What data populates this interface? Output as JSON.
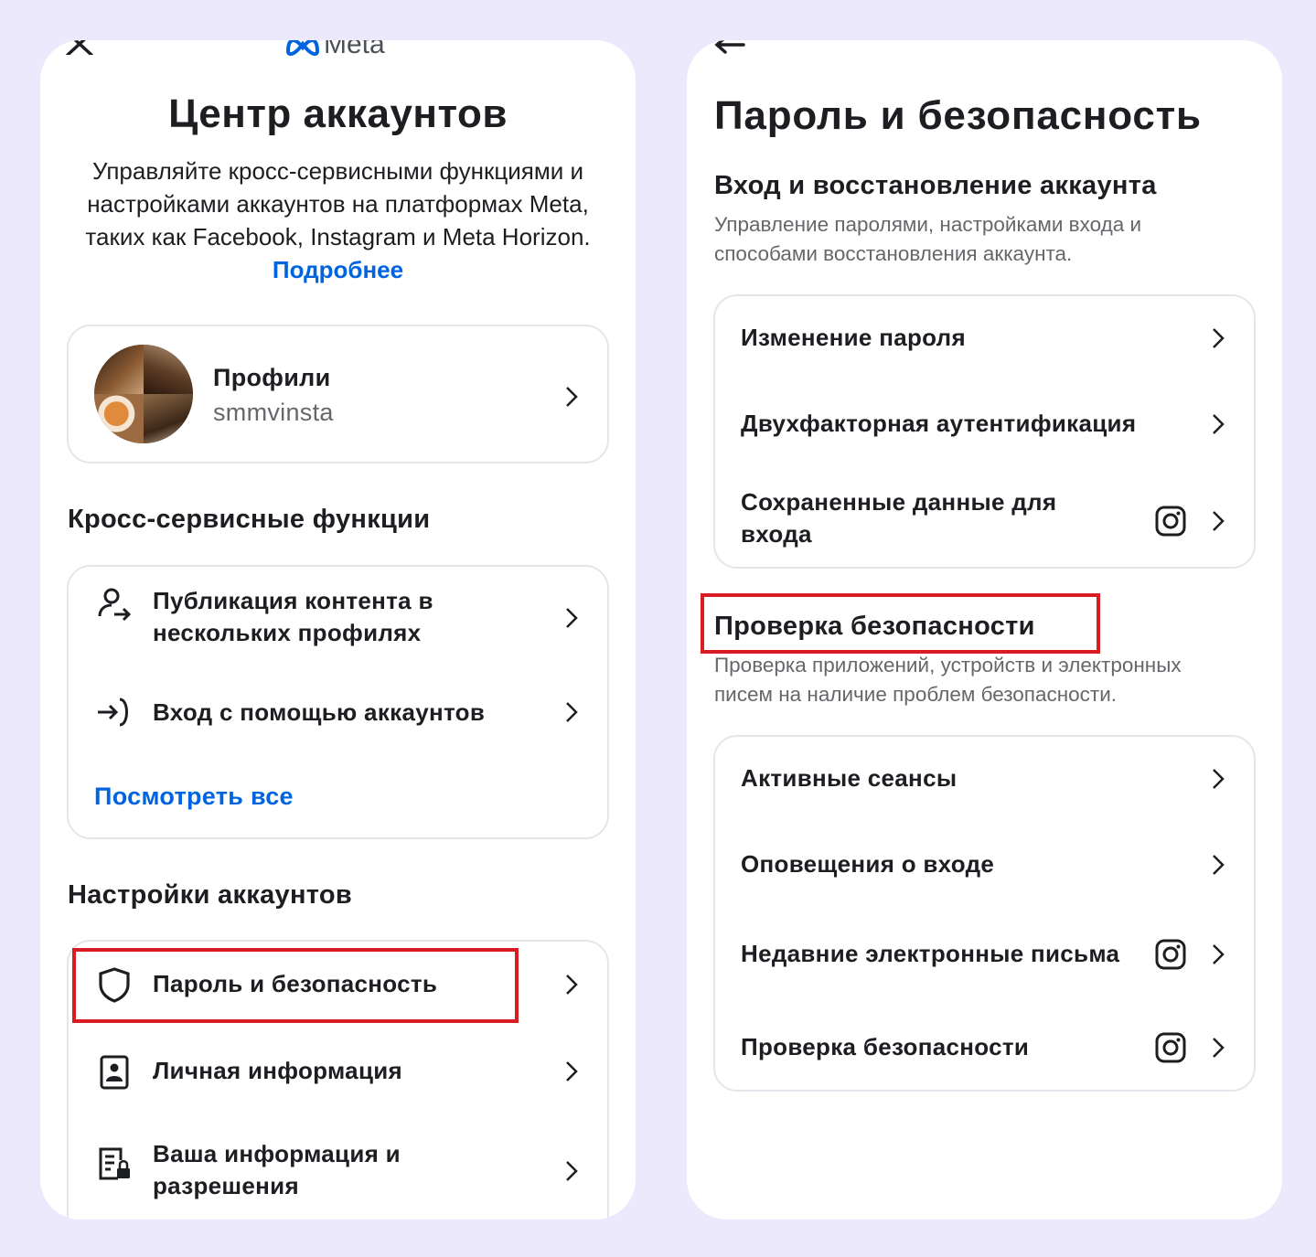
{
  "left": {
    "brand": "Meta",
    "title": "Центр аккаунтов",
    "description": "Управляйте кросс-сервисными функциями и настройками аккаунтов на платформах Meta, таких как Facebook, Instagram и Meta Horizon.",
    "learn_more": "Подробнее",
    "profiles": {
      "label": "Профили",
      "username": "smmvinsta"
    },
    "cross_section": {
      "title": "Кросс-сервисные функции",
      "items": [
        {
          "label": "Публикация контента в нескольких профилях",
          "icon": "person-share-icon"
        },
        {
          "label": "Вход с помощью аккаунтов",
          "icon": "login-arrow-icon"
        }
      ],
      "see_all": "Посмотреть все"
    },
    "settings_section": {
      "title": "Настройки аккаунтов",
      "items": [
        {
          "label": "Пароль и безопасность",
          "icon": "shield-icon",
          "highlighted": true
        },
        {
          "label": "Личная информация",
          "icon": "id-badge-icon"
        },
        {
          "label": "Ваша информация и разрешения",
          "icon": "document-lock-icon"
        }
      ]
    }
  },
  "right": {
    "title": "Пароль и безопасность",
    "login_section": {
      "title": "Вход и восстановление аккаунта",
      "description": "Управление паролями, настройками входа и способами восстановления аккаунта.",
      "items": [
        {
          "label": "Изменение пароля"
        },
        {
          "label": "Двухфакторная аутентификация"
        },
        {
          "label": "Сохраненные данные для входа",
          "icon": "instagram-icon"
        }
      ]
    },
    "security_section": {
      "title": "Проверка безопасности",
      "highlighted": true,
      "description": "Проверка приложений, устройств и электронных писем на наличие проблем безопасности.",
      "items": [
        {
          "label": "Активные сеансы"
        },
        {
          "label": "Оповещения о входе"
        },
        {
          "label": "Недавние электронные письма",
          "icon": "instagram-icon"
        },
        {
          "label": "Проверка безопасности",
          "icon": "instagram-icon"
        }
      ]
    }
  },
  "colors": {
    "background": "#ebe9fb",
    "link": "#0064e0",
    "highlight": "#d91c24",
    "muted": "#65676b"
  }
}
